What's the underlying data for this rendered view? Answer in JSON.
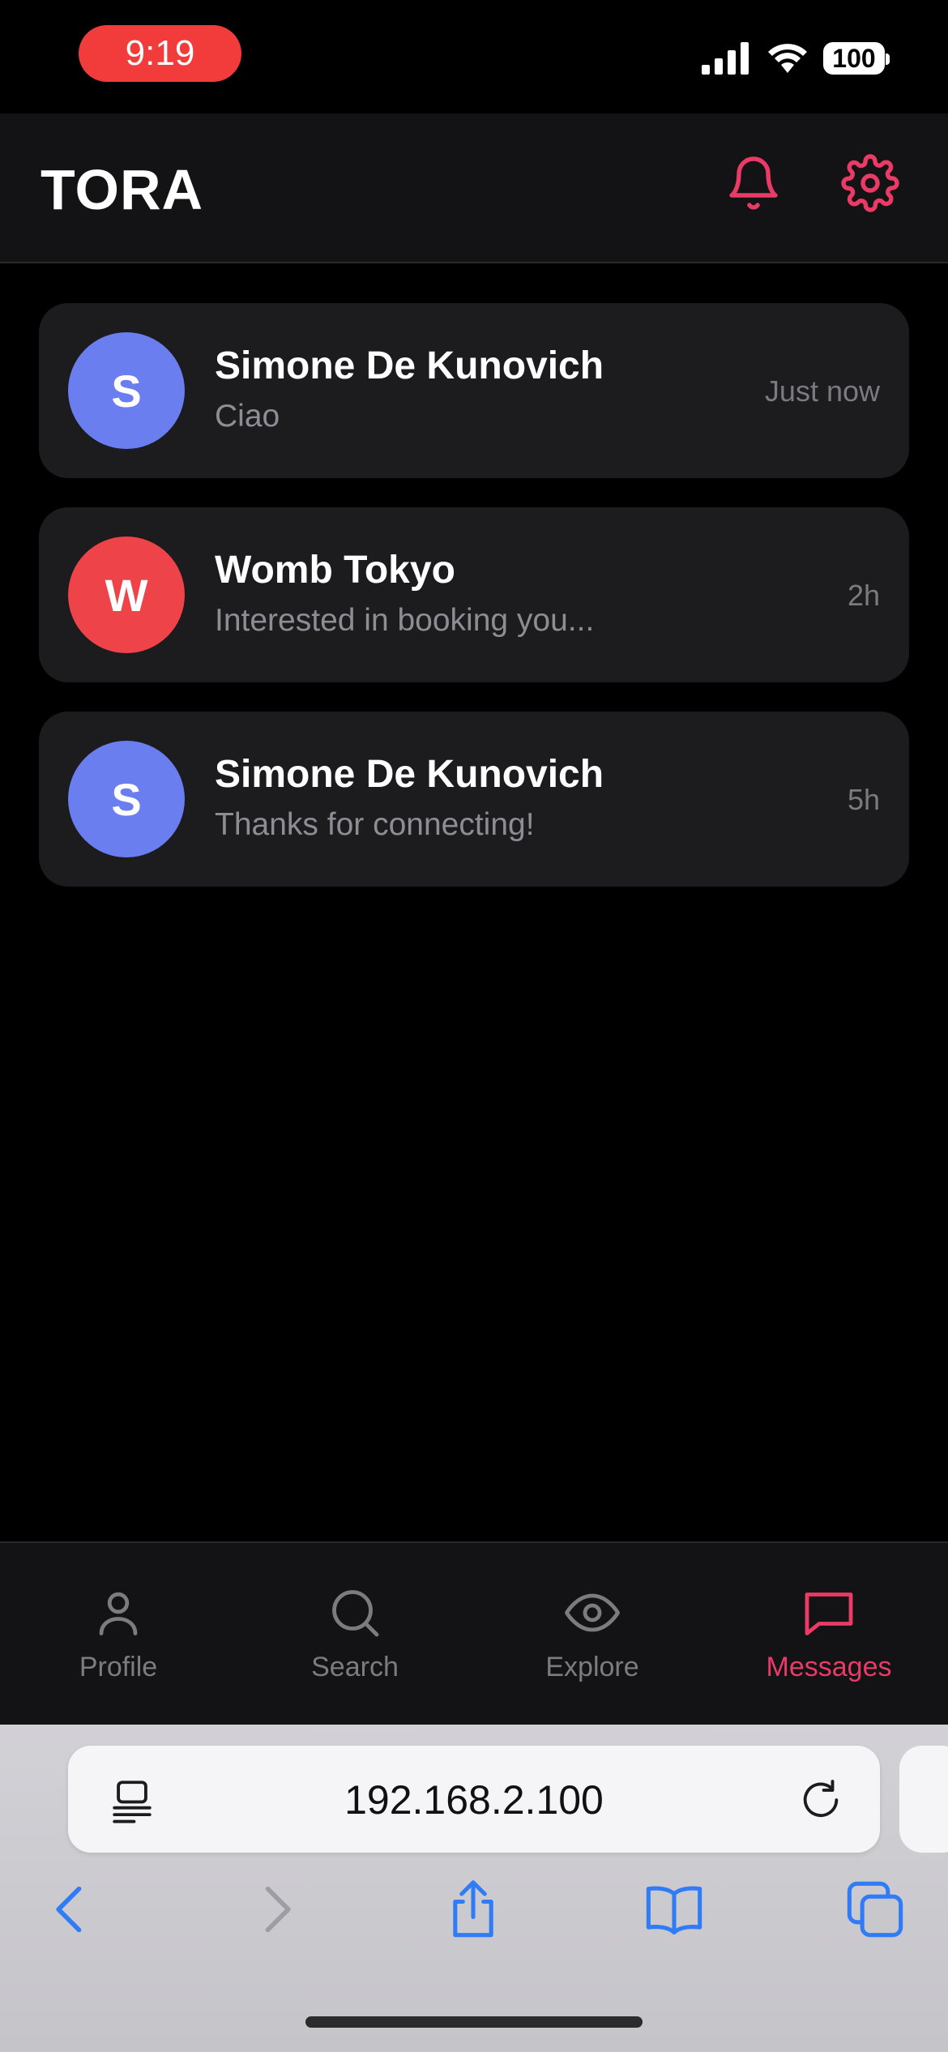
{
  "status_bar": {
    "time": "9:19",
    "battery": "100"
  },
  "header": {
    "title": "TORA",
    "accent_color": "#ea3a66"
  },
  "conversations": [
    {
      "initial": "S",
      "name": "Simone De Kunovich",
      "preview": "Ciao",
      "time": "Just now",
      "avatar_color": "#6a7ef0"
    },
    {
      "initial": "W",
      "name": "Womb Tokyo",
      "preview": "Interested in booking you...",
      "time": "2h",
      "avatar_color": "#ee4449"
    },
    {
      "initial": "S",
      "name": "Simone De Kunovich",
      "preview": "Thanks for connecting!",
      "time": "5h",
      "avatar_color": "#6a7ef0"
    }
  ],
  "nav": {
    "items": [
      {
        "label": "Profile",
        "icon": "user-icon"
      },
      {
        "label": "Search",
        "icon": "search-icon"
      },
      {
        "label": "Explore",
        "icon": "eye-icon"
      },
      {
        "label": "Messages",
        "icon": "message-icon"
      }
    ],
    "active": "Messages"
  },
  "browser": {
    "address": "192.168.2.100",
    "toolbar": [
      "back-icon",
      "forward-icon",
      "share-icon",
      "bookmarks-icon",
      "tabs-icon"
    ]
  }
}
